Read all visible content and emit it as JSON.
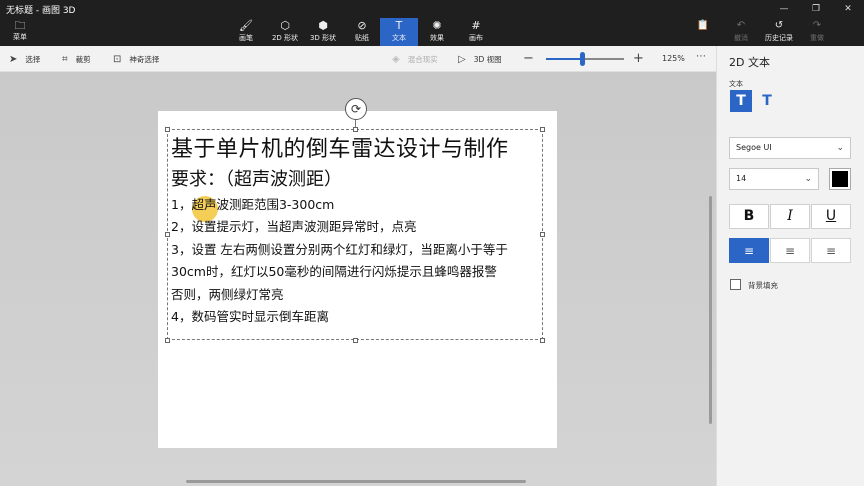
{
  "window": {
    "title": "无标题 - 画图 3D",
    "controls": [
      "—",
      "❐",
      "✕"
    ]
  },
  "ribbon": {
    "menu": {
      "icon": "folder-icon",
      "label": "菜单"
    },
    "tools": [
      {
        "id": "brushes",
        "label": "画笔",
        "icon": "brush-icon",
        "glyph": "🖌"
      },
      {
        "id": "shapes2d",
        "label": "2D 形状",
        "icon": "shapes-2d-icon",
        "glyph": "⬡"
      },
      {
        "id": "shapes3d",
        "label": "3D 形状",
        "icon": "cube-icon",
        "glyph": "⬢"
      },
      {
        "id": "stickers",
        "label": "贴纸",
        "icon": "sticker-icon",
        "glyph": "⊘"
      },
      {
        "id": "text",
        "label": "文本",
        "icon": "text-icon",
        "glyph": "T",
        "active": true
      },
      {
        "id": "effects",
        "label": "效果",
        "icon": "effects-icon",
        "glyph": "✺"
      },
      {
        "id": "canvas",
        "label": "画布",
        "icon": "canvas-icon",
        "glyph": "#"
      }
    ],
    "right_tools": [
      {
        "id": "paste",
        "label": "",
        "icon": "paste-icon",
        "glyph": "📋",
        "dim": true
      },
      {
        "id": "undo",
        "label": "撤消",
        "icon": "undo-icon",
        "glyph": "↶",
        "dim": true
      },
      {
        "id": "history",
        "label": "历史记录",
        "icon": "history-icon",
        "glyph": "↺",
        "dim": false
      },
      {
        "id": "redo",
        "label": "重做",
        "icon": "redo-icon",
        "glyph": "↷",
        "dim": true
      }
    ]
  },
  "cmdbar": {
    "select": "选择",
    "crop": "裁剪",
    "magic_select": "神奇选择",
    "mix_reality": "混合现实",
    "view3d": "3D 视图",
    "zoom": "125%",
    "zoom_fraction": 0.46,
    "more": "⋯"
  },
  "canvas": {
    "title": "基于单片机的倒车雷达设计与制作",
    "subtitle": "要求：（超声波测距）",
    "lines": [
      "1，超声波测距范围3-300cm",
      "2，设置提示灯，当超声波测距异常时，点亮",
      "3，设置 左右两侧设置分别两个红灯和绿灯，当距离小于等于",
      "30cm时，红灯以50毫秒的间隔进行闪烁提示且蜂鸣器报警",
      "否则，两侧绿灯常亮",
      "4，数码管实时显示倒车距离"
    ]
  },
  "panel": {
    "title": "2D 文本",
    "section": "文本",
    "font": "Segoe UI",
    "size": "14",
    "color": "#000000",
    "bold": "B",
    "italic": "I",
    "underline": "U",
    "align": [
      "≡",
      "≡",
      "≡"
    ],
    "background_fill": "背景填充"
  },
  "accent": "#2b66c7"
}
